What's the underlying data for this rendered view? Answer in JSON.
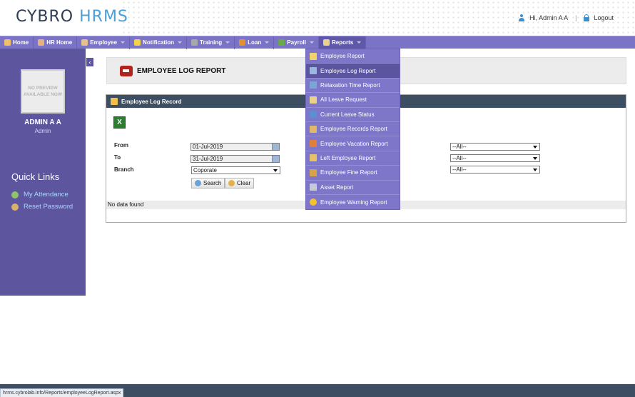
{
  "header": {
    "logo_part1": "CYBRO",
    "logo_part2": "HRMS",
    "greeting": "Hi, Admin A A",
    "separator": "|",
    "logout": "Logout"
  },
  "nav": {
    "items": [
      {
        "label": "Home",
        "icon": "home-icon",
        "caret": false
      },
      {
        "label": "HR Home",
        "icon": "hr-home-icon",
        "caret": false
      },
      {
        "label": "Employee",
        "icon": "employee-icon",
        "caret": true
      },
      {
        "label": "Notification",
        "icon": "notification-icon",
        "caret": true
      },
      {
        "label": "Training",
        "icon": "training-icon",
        "caret": true
      },
      {
        "label": "Loan",
        "icon": "loan-icon",
        "caret": true
      },
      {
        "label": "Payroll",
        "icon": "payroll-icon",
        "caret": true
      },
      {
        "label": "Reports",
        "icon": "reports-icon",
        "caret": true
      }
    ]
  },
  "sidebar": {
    "avatar_text": "NO PREVIEW AVAILABLE NOW",
    "name": "ADMIN A A",
    "role": "Admin",
    "quick_links_title": "Quick Links",
    "links": [
      {
        "label": "My Attendance",
        "color": "#8fc46a"
      },
      {
        "label": "Reset Password",
        "color": "#d8b26a"
      }
    ],
    "toggle": "‹"
  },
  "page": {
    "title": "EMPLOYEE LOG REPORT"
  },
  "panel": {
    "title": "Employee Log Record",
    "excel_icon": "X",
    "from_label": "From",
    "from_value": "01-Jul-2019",
    "to_label": "To",
    "to_value": "31-Jul-2019",
    "branch_label": "Branch",
    "branch_value": "Coporate",
    "right_select_1": "--All--",
    "right_select_2": "--All--",
    "right_select_3": "--All--",
    "search_label": "Search",
    "clear_label": "Clear",
    "no_data": "No data found"
  },
  "reports_menu": {
    "items": [
      {
        "label": "Employee Report",
        "icon_color": "#f2d36b"
      },
      {
        "label": "Employee Log Report",
        "icon_color": "#9bb7e0"
      },
      {
        "label": "Relaxation Time Report",
        "icon_color": "#7aa6d6"
      },
      {
        "label": "All Leave Request",
        "icon_color": "#e9d28a"
      },
      {
        "label": "Current Leave Status",
        "icon_color": "#5c8fd1"
      },
      {
        "label": "Employee Records Report",
        "icon_color": "#e0b86c"
      },
      {
        "label": "Employee Vacation Report",
        "icon_color": "#e0803c"
      },
      {
        "label": "Left Employee Report",
        "icon_color": "#e6c06a"
      },
      {
        "label": "Employee Fine Report",
        "icon_color": "#d8a24a"
      },
      {
        "label": "Asset Report",
        "icon_color": "#c8c8d8"
      },
      {
        "label": "Employee Warning Report",
        "icon_color": "#f2c230"
      }
    ],
    "highlighted_index": 1
  },
  "status": {
    "url": "hrms.cybrolab.info/Reports/employeeLogReport.aspx"
  }
}
